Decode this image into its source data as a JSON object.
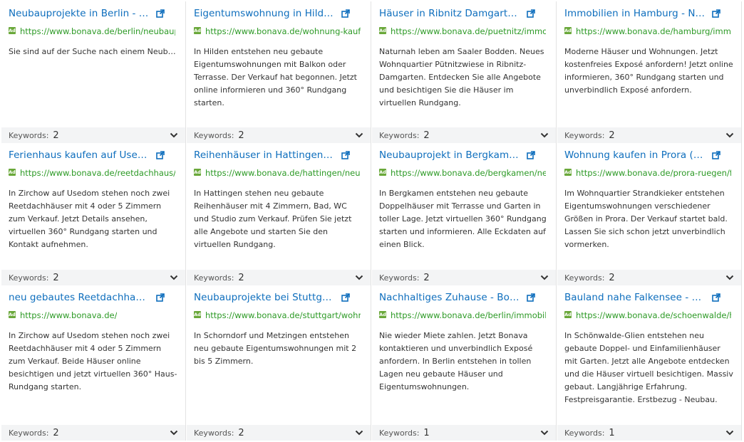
{
  "keywords_label": "Keywords:",
  "ad_badge": "Ad",
  "colors": {
    "title": "#0e6ebd",
    "url": "#2d9a26",
    "ad_badge": "#6aa83a",
    "footer_bg": "#f3f4f5"
  },
  "icons": {
    "external": "external-link-icon",
    "chevron": "chevron-down-icon"
  },
  "cards": [
    {
      "title": "Neubauprojekte in Berlin - H...",
      "url": "https://www.bonava.de/berlin/neubauprojekte",
      "desc": "Sie sind auf der Suche nach einem Neubau in Berlin? Wir verraten Ihnen alles, was Sie...",
      "keywords": "2"
    },
    {
      "title": "Eigentumswohnung in Hilden...",
      "url": "https://www.bonava.de/wohnung-kaufen/hilden",
      "desc": "In Hilden entstehen neu gebaute Eigentumswohnungen mit Balkon oder Terrasse. Der Verkauf hat begonnen. Jetzt online informieren und 360° Rundgang starten.",
      "keywords": "2"
    },
    {
      "title": "Häuser in Ribnitz Damgarten ...",
      "url": "https://www.bonava.de/puetnitz/immobilien",
      "desc": "Naturnah leben am Saaler Bodden. Neues Wohnquartier Pütnitzwiese in Ribnitz-Damgarten. Entdecken Sie alle Angebote und besichtigen Sie die Häuser im virtuellen Rundgang.",
      "keywords": "2"
    },
    {
      "title": "Immobilien in Hamburg - Neu...",
      "url": "https://www.bonava.de/hamburg/immobilien",
      "desc": "Moderne Häuser und Wohnungen. Jetzt kostenfreies Exposé anfordern! Jetzt online informieren, 360° Rundgang starten und unverbindlich Exposé anfordern.",
      "keywords": "2"
    },
    {
      "title": "Ferienhaus kaufen auf Usedo...",
      "url": "https://www.bonava.de/reetdachhaus/ferienhaus",
      "desc": "In Zirchow auf Usedom stehen noch zwei Reetdachhäuser mit 4 oder 5 Zimmern zum Verkauf. Jetzt Details ansehen, virtuellen 360° Rundgang starten und Kontakt aufnehmen.",
      "keywords": "2"
    },
    {
      "title": "Reihenhäuser in Hattingen - ...",
      "url": "https://www.bonava.de/hattingen/neubauprojekt",
      "desc": "In Hattingen stehen neu gebaute Reihenhäuser mit 4 Zimmern, Bad, WC und Studio zum Verkauf. Prüfen Sie jetzt alle Angebote und starten Sie den virtuellen Rundgang.",
      "keywords": "2"
    },
    {
      "title": "Neubauprojekt in Bergkame...",
      "url": "https://www.bonava.de/bergkamen/neubauprojekt",
      "desc": "In Bergkamen entstehen neu gebaute Doppelhäuser mit Terrasse und Garten in toller Lage. Jetzt virtuellen 360° Rundgang starten und informieren. Alle Eckdaten auf einen Blick.",
      "keywords": "2"
    },
    {
      "title": "Wohnung kaufen in Prora (Bi...",
      "url": "https://www.bonava.de/prora-ruegen/ferienwohnung",
      "desc": "Im Wohnquartier Strandkieker entstehen Eigentumswohnungen verschiedener Größen in Prora. Der Verkauf startet bald. Lassen Sie sich schon jetzt unverbindlich vormerken.",
      "keywords": "2"
    },
    {
      "title": "neu gebautes Reetdachhaus ...",
      "url": "https://www.bonava.de/",
      "desc": "In Zirchow auf Usedom stehen noch zwei Reetdachhäuser mit 4 oder 5 Zimmern zum Verkauf. Beide Häuser online besichtigen und jetzt virtuellen 360° Haus-Rundgang starten.",
      "keywords": "2"
    },
    {
      "title": "Neubauprojekte bei Stuttgar...",
      "url": "https://www.bonava.de/stuttgart/wohnungen",
      "desc": "In Schorndorf und Metzingen entstehen neu gebaute Eigentumswohnungen mit 2 bis 5 Zimmern.",
      "keywords": "2"
    },
    {
      "title": "Nachhaltiges Zuhause - Bona...",
      "url": "https://www.bonava.de/berlin/immobilien",
      "desc": "Nie wieder Miete zahlen. Jetzt Bonava kontaktieren und unverbindlich Exposé anfordern. In Berlin entstehen in tollen Lagen neu gebaute Häuser und Eigentumswohnungen.",
      "keywords": "1"
    },
    {
      "title": "Bauland nahe Falkensee - Ne...",
      "url": "https://www.bonava.de/schoenwalde/haus-kaufen",
      "desc": "In Schönwalde-Glien entstehen neu gebaute Doppel- und Einfamilienhäuser mit Garten. Jetzt alle Angebote entdecken und die Häuser virtuell besichtigen. Massiv gebaut. Langjährige Erfahrung. Festpreisgarantie. Erstbezug - Neubau.",
      "keywords": "1"
    }
  ]
}
